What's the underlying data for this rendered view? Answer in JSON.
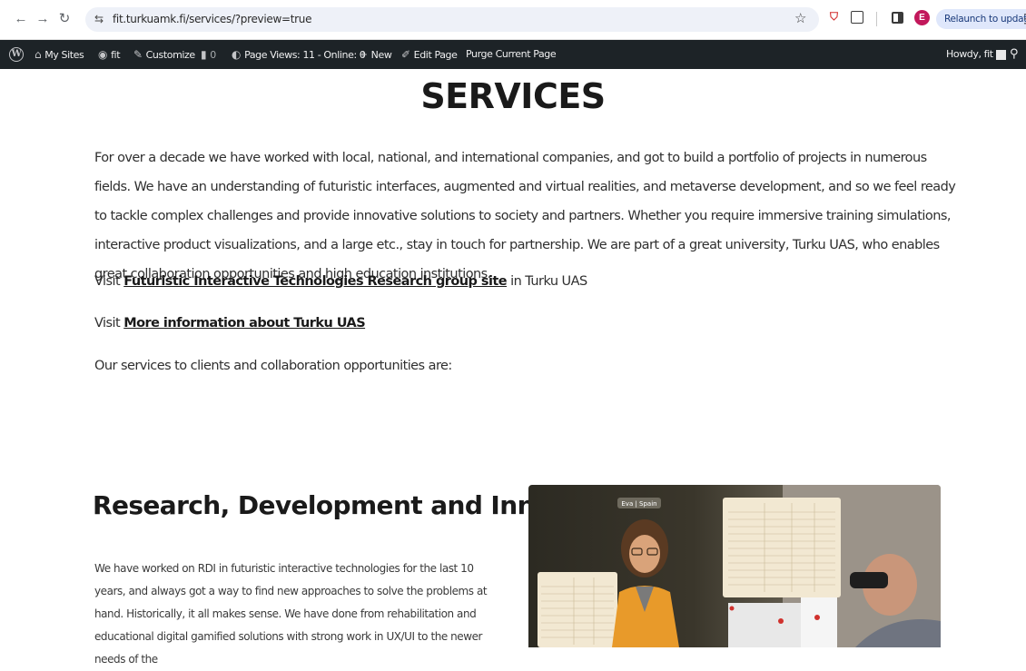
{
  "browser": {
    "url": "fit.turkuamk.fi/services/?preview=true",
    "relaunch_label": "Relaunch to update",
    "profile_initial": "E"
  },
  "adminbar": {
    "my_sites": "My Sites",
    "site_name": "fit",
    "customize": "Customize",
    "comments_count": "0",
    "page_views": "Page Views: 11 - Online: 0",
    "new": "New",
    "edit_page": "Edit Page",
    "purge": "Purge Current Page",
    "howdy": "Howdy, fit"
  },
  "page": {
    "title": "SERVICES",
    "intro": "For over a decade we have worked with local, national, and international companies, and got to build a portfolio of projects in numerous fields. We have an understanding of futuristic interfaces, augmented and virtual realities, and metaverse development, and so we feel ready to tackle complex challenges and provide innovative solutions to society and partners. Whether you require immersive training simulations, interactive product visualizations, and a large etc., stay in touch for partnership. We are part of a great university, Turku UAS, who enables great collaboration opportunities and high education institutions.",
    "visit1_prefix": "Visit",
    "visit1_link": "Futuristic Interactive Technologies Research group site",
    "visit1_suffix": "in Turku UAS",
    "visit2_prefix": "Visit",
    "visit2_link": "More information about Turku UAS",
    "services_lead": "Our services to clients and collaboration opportunities are:",
    "section_title": "Research, Development and Innovation",
    "section_body": "We have worked on RDI in futuristic interactive technologies for the last 10 years, and always got a way to find new approaches to solve the problems at hand. Historically, it all makes sense. We have done from rehabilitation and educational digital gamified solutions with strong work in UX/UI to the newer needs of the",
    "image_label": "Eva | Spain"
  }
}
